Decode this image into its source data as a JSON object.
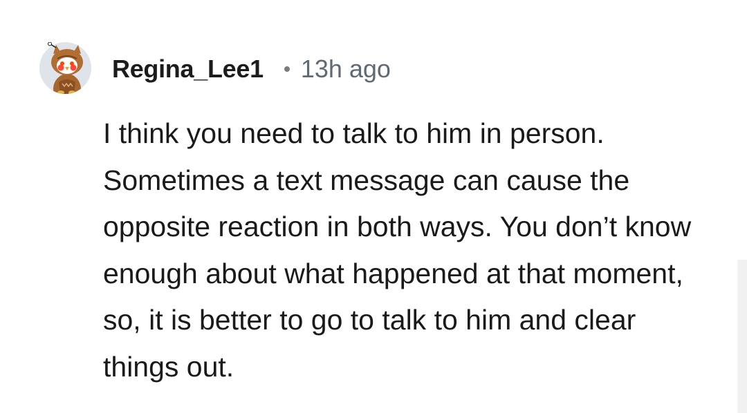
{
  "comment": {
    "username": "Regina_Lee1",
    "separator": "•",
    "timestamp": "13h ago",
    "body": "I think you need to talk to him in person. Sometimes a text message can cause the opposite reaction in both ways. You don’t know enough about what happened at that moment, so, it is better to go to talk to him and clear things out.",
    "avatar_icon": "owl-snoo-avatar-icon"
  },
  "colors": {
    "background": "#ffffff",
    "username": "#1c1c1c",
    "timestamp": "#5f6a73",
    "body_text": "#1a1a1b",
    "scrollbar_track": "#f1f1f1"
  }
}
